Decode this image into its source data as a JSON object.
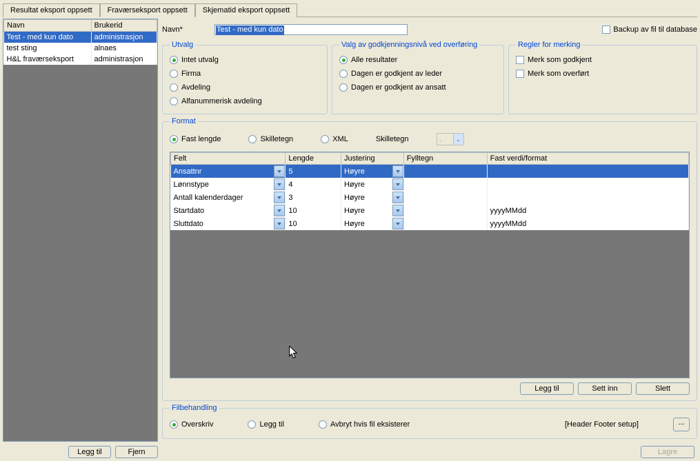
{
  "tabs": [
    "Resultat eksport oppsett",
    "Fraværseksport oppsett",
    "Skjematid eksport oppsett"
  ],
  "activeTab": 1,
  "leftList": {
    "headers": [
      "Navn",
      "Brukerid"
    ],
    "rows": [
      {
        "navn": "Test - med kun dato",
        "brukerid": "administrasjon",
        "selected": true
      },
      {
        "navn": "test sting",
        "brukerid": "alnaes"
      },
      {
        "navn": "H&L fraværseksport",
        "brukerid": "administrasjon"
      }
    ],
    "buttons": {
      "add": "Legg til",
      "remove": "Fjern"
    }
  },
  "navn": {
    "label": "Navn*",
    "value": "Test - med kun dato"
  },
  "backup": {
    "label": "Backup av fil til database"
  },
  "utvalg": {
    "legend": "Utvalg",
    "options": [
      "Intet utvalg",
      "Firma",
      "Avdeling",
      "Alfanummerisk avdeling"
    ],
    "checked": 0
  },
  "valg": {
    "legend": "Valg av godkjenningsnivå ved overføring",
    "options": [
      "Alle resultater",
      "Dagen er godkjent av leder",
      "Dagen er godkjent av ansatt"
    ],
    "checked": 0
  },
  "regler": {
    "legend": "Regler for merking",
    "options": [
      "Merk som godkjent",
      "Merk som overført"
    ]
  },
  "format": {
    "legend": "Format",
    "radios": [
      "Fast lengde",
      "Skilletegn",
      "XML"
    ],
    "checked": 0,
    "skilletegnLabel": "Skilletegn",
    "skilletegnValue": ",",
    "gridHeaders": [
      "Felt",
      "Lengde",
      "Justering",
      "Fylltegn",
      "Fast verdi/format"
    ],
    "rows": [
      {
        "felt": "Ansattnr",
        "lengde": "5",
        "just": "Høyre",
        "fyll": "",
        "fast": "",
        "sel": true
      },
      {
        "felt": "Lønnstype",
        "lengde": "4",
        "just": "Høyre",
        "fyll": "",
        "fast": ""
      },
      {
        "felt": "Antall kalenderdager",
        "lengde": "3",
        "just": "Høyre",
        "fyll": "",
        "fast": ""
      },
      {
        "felt": "Startdato",
        "lengde": "10",
        "just": "Høyre",
        "fyll": "",
        "fast": "yyyyMMdd"
      },
      {
        "felt": "Sluttdato",
        "lengde": "10",
        "just": "Høyre",
        "fyll": "",
        "fast": "yyyyMMdd"
      }
    ],
    "buttons": {
      "add": "Legg til",
      "insert": "Sett inn",
      "delete": "Slett"
    }
  },
  "filbehandling": {
    "legend": "Filbehandling",
    "options": [
      "Overskriv",
      "Legg til",
      "Avbryt hvis fil eksisterer"
    ],
    "checked": 0,
    "headerFooter": "[Header Footer setup]",
    "dots": "..."
  },
  "lagre": "Lagre"
}
